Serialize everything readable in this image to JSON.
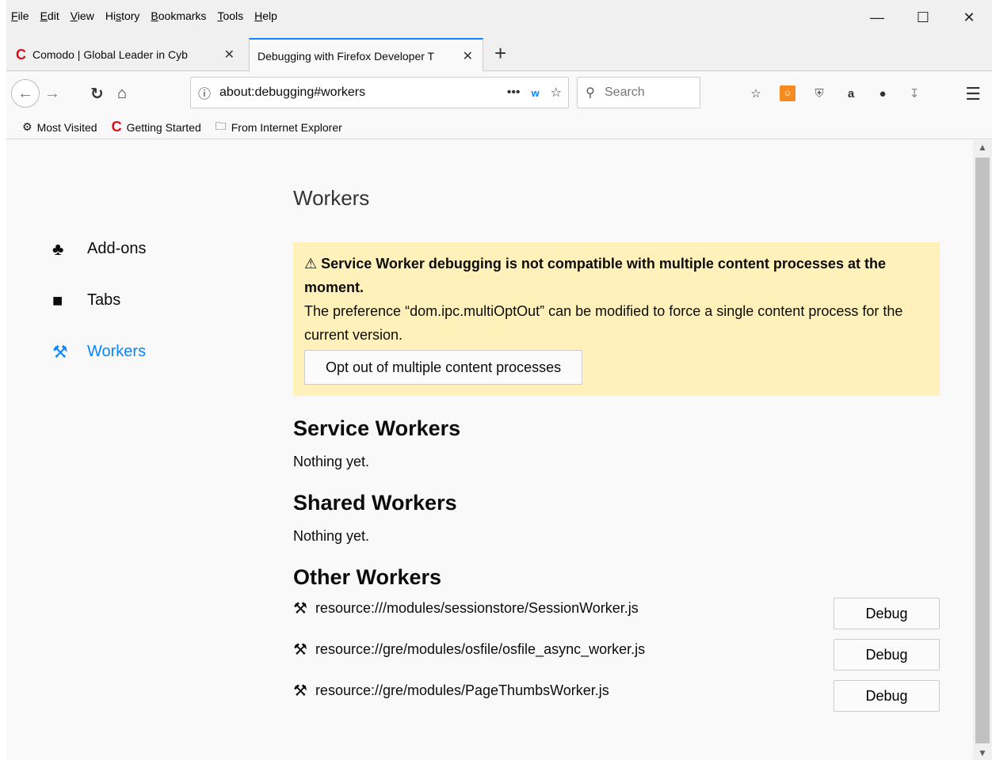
{
  "menubar": {
    "items": [
      {
        "key": "F",
        "rest": "ile"
      },
      {
        "key": "E",
        "rest": "dit"
      },
      {
        "key": "V",
        "rest": "iew"
      },
      {
        "pre": "Hi",
        "key": "s",
        "rest": "tory"
      },
      {
        "key": "B",
        "rest": "ookmarks"
      },
      {
        "key": "T",
        "rest": "ools"
      },
      {
        "key": "H",
        "rest": "elp"
      }
    ]
  },
  "tabs": [
    {
      "title": "Comodo | Global Leader in Cyb",
      "active": false
    },
    {
      "title": "Debugging with Firefox Developer T",
      "active": true
    }
  ],
  "urlbar": {
    "value": "about:debugging#workers"
  },
  "searchbar": {
    "placeholder": "Search"
  },
  "bookmarks": {
    "items": [
      "Most Visited",
      "Getting Started",
      "From Internet Explorer"
    ]
  },
  "sidebar": {
    "items": [
      {
        "label": "Add-ons",
        "icon": "puzzle-icon"
      },
      {
        "label": "Tabs",
        "icon": "tab-icon"
      },
      {
        "label": "Workers",
        "icon": "tools-icon",
        "active": true
      }
    ]
  },
  "main": {
    "title": "Workers",
    "warning": {
      "title": "Service Worker debugging is not compatible with multiple content processes at the moment.",
      "body": "The preference “dom.ipc.multiOptOut” can be modified to force a single content process for the current version.",
      "button": "Opt out of multiple content processes"
    },
    "service_workers": {
      "title": "Service Workers",
      "empty": "Nothing yet."
    },
    "shared_workers": {
      "title": "Shared Workers",
      "empty": "Nothing yet."
    },
    "other_workers": {
      "title": "Other Workers",
      "items": [
        {
          "name": "resource:///modules/sessionstore/SessionWorker.js",
          "button": "Debug"
        },
        {
          "name": "resource://gre/modules/osfile/osfile_async_worker.js",
          "button": "Debug"
        },
        {
          "name": "resource://gre/modules/PageThumbsWorker.js",
          "button": "Debug"
        }
      ]
    }
  },
  "colors": {
    "accent": "#0a84ff",
    "warning_bg": "#fff1b9",
    "comodo": "#d9101a"
  }
}
